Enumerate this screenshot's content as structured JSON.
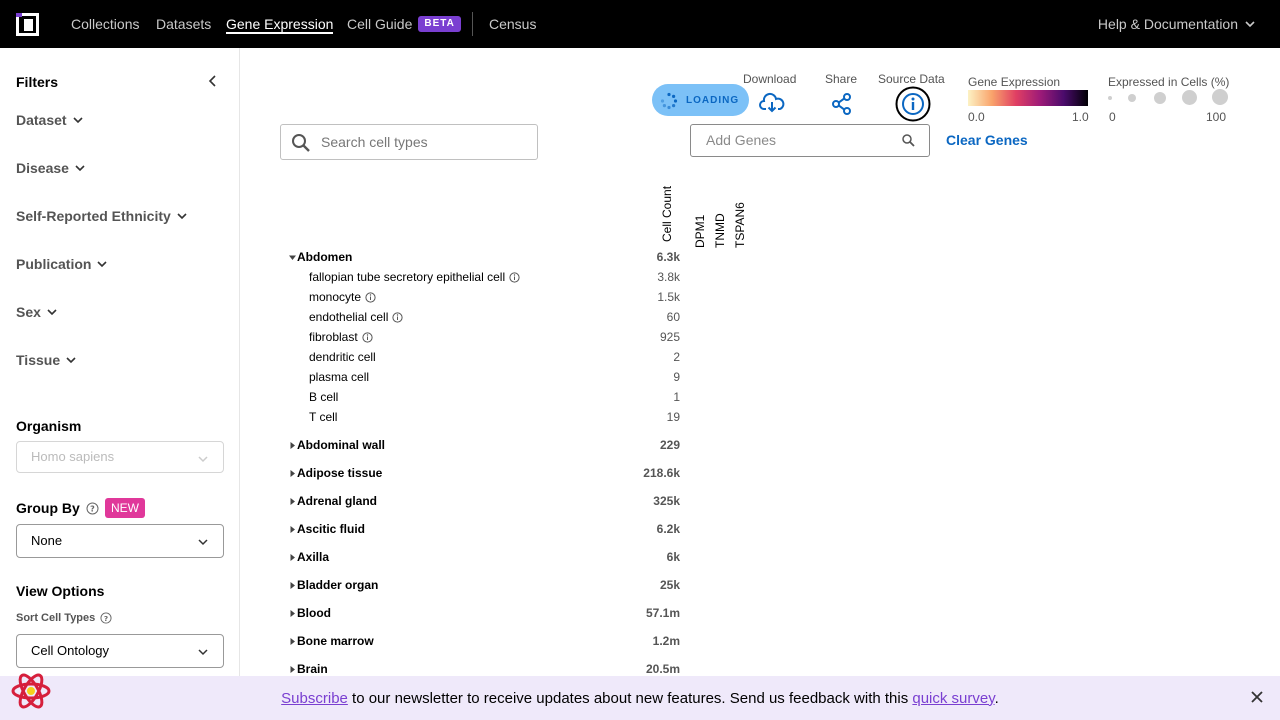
{
  "nav": {
    "items": [
      "Collections",
      "Datasets",
      "Gene Expression",
      "Cell Guide",
      "Census"
    ],
    "beta_label": "BETA",
    "help_label": "Help & Documentation"
  },
  "sidebar": {
    "filters_title": "Filters",
    "filters": [
      "Dataset",
      "Disease",
      "Self-Reported Ethnicity",
      "Publication",
      "Sex",
      "Tissue"
    ],
    "organism_title": "Organism",
    "organism_value": "Homo sapiens",
    "group_by_title": "Group By",
    "new_badge": "NEW",
    "group_by_value": "None",
    "view_options_title": "View Options",
    "sort_label": "Sort Cell Types",
    "sort_value": "Cell Ontology"
  },
  "toolbar": {
    "loading_label": "LOADING",
    "download_label": "Download",
    "share_label": "Share",
    "source_label": "Source Data",
    "gene_expression_label": "Gene Expression",
    "ge_min": "0.0",
    "ge_max": "1.0",
    "expressed_label": "Expressed in Cells (%)",
    "ex_min": "0",
    "ex_max": "100"
  },
  "search": {
    "placeholder": "Search cell types"
  },
  "genes": {
    "placeholder": "Add Genes",
    "clear_label": "Clear Genes",
    "column_header": "Cell Count",
    "list": [
      "DPM1",
      "TNMD",
      "TSPAN6"
    ]
  },
  "tissues": [
    {
      "name": "Abdomen",
      "count": "6.3k",
      "expanded": true,
      "cells": [
        {
          "name": "fallopian tube secretory epithelial cell",
          "count": "3.8k",
          "info": true
        },
        {
          "name": "monocyte",
          "count": "1.5k",
          "info": true
        },
        {
          "name": "endothelial cell",
          "count": "60",
          "info": true
        },
        {
          "name": "fibroblast",
          "count": "925",
          "info": true
        },
        {
          "name": "dendritic cell",
          "count": "2",
          "info": false
        },
        {
          "name": "plasma cell",
          "count": "9",
          "info": false
        },
        {
          "name": "B cell",
          "count": "1",
          "info": false
        },
        {
          "name": "T cell",
          "count": "19",
          "info": false
        }
      ]
    },
    {
      "name": "Abdominal wall",
      "count": "229"
    },
    {
      "name": "Adipose tissue",
      "count": "218.6k"
    },
    {
      "name": "Adrenal gland",
      "count": "325k"
    },
    {
      "name": "Ascitic fluid",
      "count": "6.2k"
    },
    {
      "name": "Axilla",
      "count": "6k"
    },
    {
      "name": "Bladder organ",
      "count": "25k"
    },
    {
      "name": "Blood",
      "count": "57.1m"
    },
    {
      "name": "Bone marrow",
      "count": "1.2m"
    },
    {
      "name": "Brain",
      "count": "20.5m"
    }
  ],
  "banner": {
    "subscribe_link": "Subscribe",
    "text": " to our newsletter to receive updates about new features. Send us feedback with this ",
    "survey_link": "quick survey",
    "end": "."
  },
  "colors": {
    "nav_bg": "#000000",
    "accent_blue": "#0b67c2",
    "beta_purple": "#7a3fd1",
    "new_pink": "#e0389a",
    "banner_bg": "#efe9fa"
  }
}
